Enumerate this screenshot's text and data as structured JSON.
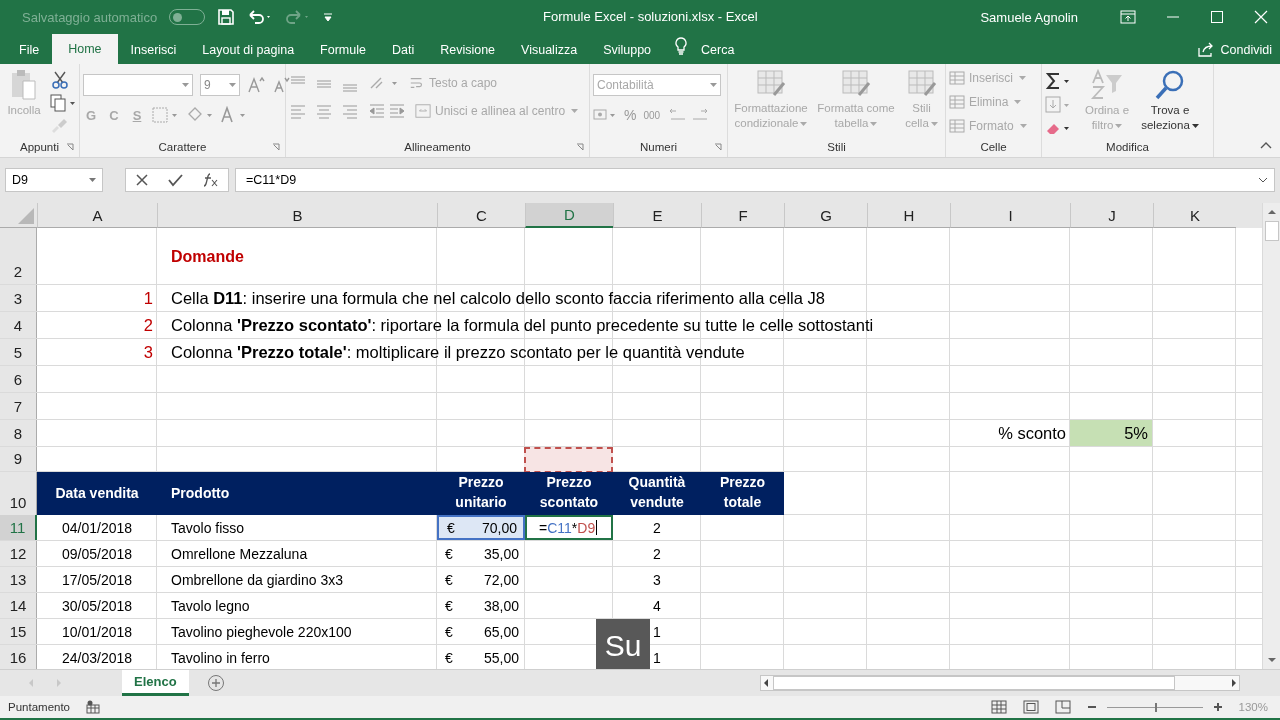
{
  "title_bar": {
    "autosave_label": "Salvataggio automatico",
    "autosave_on": false,
    "title": "Formule Excel - soluzioni.xlsx  -  Excel",
    "user": "Samuele Agnolin"
  },
  "tabs": [
    {
      "label": "File",
      "selected": false
    },
    {
      "label": "Home",
      "selected": true
    },
    {
      "label": "Inserisci",
      "selected": false
    },
    {
      "label": "Layout di pagina",
      "selected": false
    },
    {
      "label": "Formule",
      "selected": false
    },
    {
      "label": "Dati",
      "selected": false
    },
    {
      "label": "Revisione",
      "selected": false
    },
    {
      "label": "Visualizza",
      "selected": false
    },
    {
      "label": "Sviluppo",
      "selected": false
    }
  ],
  "search_label": "Cerca",
  "share_label": "Condividi",
  "ribbon": {
    "clipboard": {
      "label": "Appunti",
      "paste": {
        "label": "Incolla",
        "disabled": true
      }
    },
    "font": {
      "label": "Carattere",
      "size": "9",
      "styles": [
        {
          "label": "G",
          "disabled": true
        },
        {
          "label": "C",
          "disabled": true
        },
        {
          "label": "S",
          "disabled": true
        }
      ]
    },
    "alignment": {
      "label": "Allineamento",
      "wrap": {
        "label": "Testo a capo",
        "disabled": true
      },
      "merge": {
        "label": "Unisci e allinea al centro",
        "disabled": true
      }
    },
    "number": {
      "label": "Numeri",
      "format": "Contabilità",
      "percent": "%",
      "thousands": "000"
    },
    "styles": {
      "label": "Stili",
      "buttons": [
        {
          "label": "Formattazione condizionale",
          "disabled": true
        },
        {
          "label": "Formatta come tabella",
          "disabled": true
        },
        {
          "label": "Stili cella",
          "disabled": true
        }
      ]
    },
    "cells": {
      "label": "Celle",
      "buttons": [
        {
          "label": "Inserisci",
          "disabled": true
        },
        {
          "label": "Elimina",
          "disabled": true
        },
        {
          "label": "Formato",
          "disabled": true
        }
      ]
    },
    "editing": {
      "label": "Modifica",
      "sort": {
        "label": "Ordina e filtro",
        "disabled": true
      },
      "find": {
        "label": "Trova e seleziona",
        "disabled": false
      }
    }
  },
  "formula_bar": {
    "name_box": "D9",
    "formula": "=C11*D9"
  },
  "columns": [
    {
      "label": "A",
      "selected": false
    },
    {
      "label": "B",
      "selected": false
    },
    {
      "label": "C",
      "selected": false
    },
    {
      "label": "D",
      "selected": true
    },
    {
      "label": "E",
      "selected": false
    },
    {
      "label": "F",
      "selected": false
    },
    {
      "label": "G",
      "selected": false
    },
    {
      "label": "H",
      "selected": false
    },
    {
      "label": "I",
      "selected": false
    },
    {
      "label": "J",
      "selected": false
    },
    {
      "label": "K",
      "selected": false
    }
  ],
  "rows": [
    {
      "number": "2",
      "kind": "heading",
      "selected": false,
      "text": "Domande"
    },
    {
      "number": "3",
      "kind": "question",
      "selected": false,
      "index": "1",
      "text": "Cella **D11**: inserire una formula che nel calcolo dello sconto faccia riferimento alla cella J8"
    },
    {
      "number": "4",
      "kind": "question",
      "selected": false,
      "index": "2",
      "text": "Colonna **'Prezzo scontato'**: riportare la formula del punto precedente su tutte le celle sottostanti"
    },
    {
      "number": "5",
      "kind": "question",
      "selected": false,
      "index": "3",
      "text": "Colonna **'Prezzo totale'**: moltiplicare il prezzo scontato per le quantità vendute"
    },
    {
      "number": "6",
      "kind": "empty",
      "selected": false
    },
    {
      "number": "7",
      "kind": "empty",
      "selected": false
    },
    {
      "number": "8",
      "kind": "parameter",
      "selected": false,
      "label": "% sconto",
      "value": "5%"
    },
    {
      "number": "9",
      "kind": "marquee",
      "selected": false,
      "color": "#c0504d"
    },
    {
      "number": "10",
      "kind": "table-header",
      "selected": false,
      "headers": [
        "Data vendita",
        "Prodotto",
        "Prezzo unitario",
        "Prezzo scontato",
        "Quantità vendute",
        "Prezzo totale"
      ]
    },
    {
      "number": "11",
      "kind": "record",
      "selected": true,
      "date": "04/01/2018",
      "product": "Tavolo fisso",
      "currency": "€",
      "price": "70,00",
      "price_referenced": true,
      "formula_parts": [
        {
          "kind": "operator",
          "text": "="
        },
        {
          "kind": "reference",
          "text": "C11",
          "color": "#4472c4"
        },
        {
          "kind": "operator",
          "text": "*"
        },
        {
          "kind": "reference",
          "text": "D9",
          "color": "#c0504d"
        }
      ],
      "quantity": "2"
    },
    {
      "number": "12",
      "kind": "record",
      "selected": false,
      "date": "09/05/2018",
      "product": "Omrellone Mezzaluna",
      "currency": "€",
      "price": "35,00",
      "price_referenced": false,
      "quantity": "2"
    },
    {
      "number": "13",
      "kind": "record",
      "selected": false,
      "date": "17/05/2018",
      "product": "Ombrellone da giardino 3x3",
      "currency": "€",
      "price": "72,00",
      "price_referenced": false,
      "quantity": "3"
    },
    {
      "number": "14",
      "kind": "record",
      "selected": false,
      "date": "30/05/2018",
      "product": "Tavolo legno",
      "currency": "€",
      "price": "38,00",
      "price_referenced": false,
      "quantity": "4"
    },
    {
      "number": "15",
      "kind": "record",
      "selected": false,
      "date": "10/01/2018",
      "product": "Tavolino pieghevole 220x100",
      "currency": "€",
      "price": "65,00",
      "price_referenced": false,
      "quantity": "1"
    },
    {
      "number": "16",
      "kind": "record",
      "selected": false,
      "date": "24/03/2018",
      "product": "Tavolino in ferro",
      "currency": "€",
      "price": "55,00",
      "price_referenced": false,
      "quantity": "1"
    }
  ],
  "sheet_tabs": [
    {
      "label": "Elenco",
      "selected": true
    }
  ],
  "status_bar": {
    "mode": "Puntamento",
    "zoom": "130%",
    "zoom_level": {
      "level": 0.5
    }
  },
  "caption_overlay": "Su"
}
